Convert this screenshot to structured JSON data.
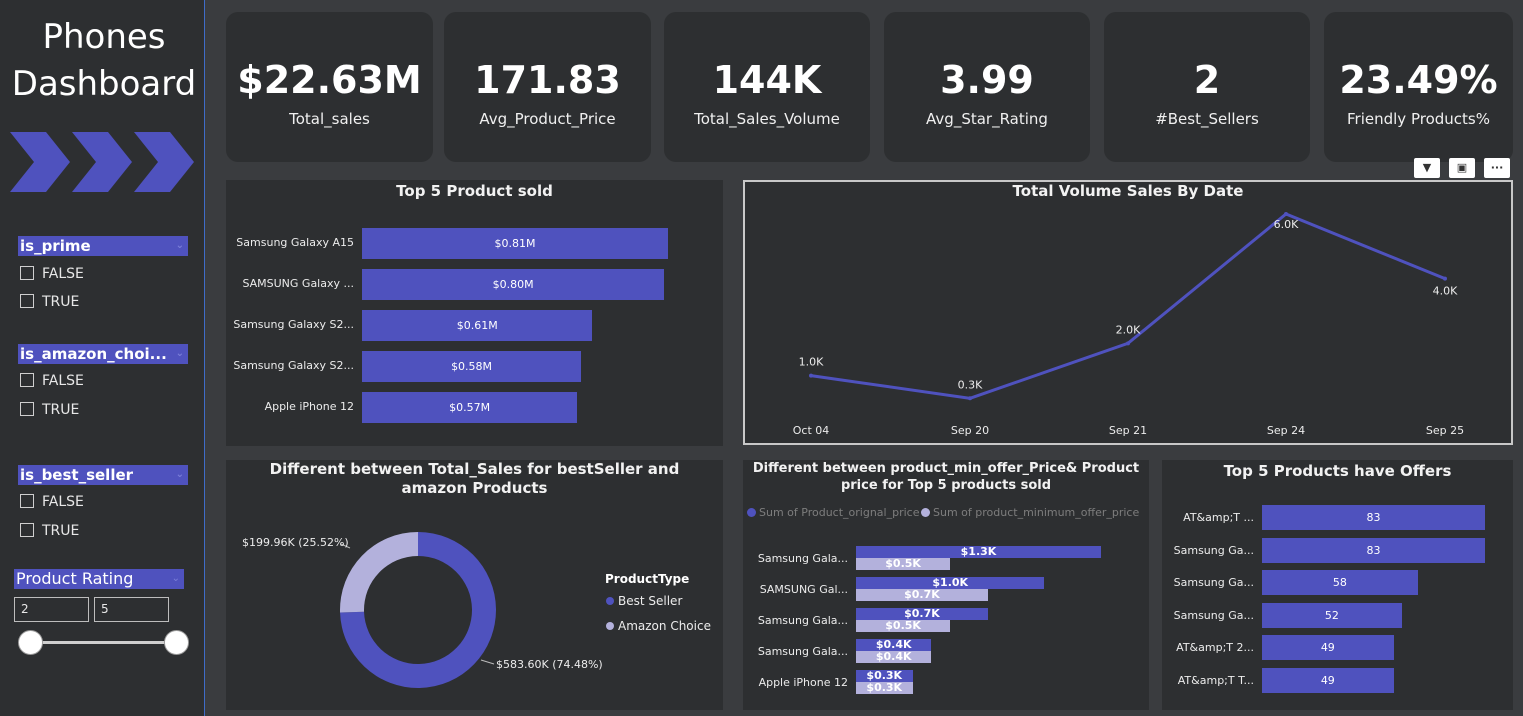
{
  "dashboard": {
    "title_line1": "Phones",
    "title_line2": "Dashboard"
  },
  "slicers": {
    "is_prime": {
      "label": "is_prime",
      "options": [
        "FALSE",
        "TRUE"
      ]
    },
    "is_amazon_choice": {
      "label": "is_amazon_choi...",
      "options": [
        "FALSE",
        "TRUE"
      ]
    },
    "is_best_seller": {
      "label": "is_best_seller",
      "options": [
        "FALSE",
        "TRUE"
      ]
    },
    "product_rating": {
      "label": "Product Rating",
      "min": "2",
      "max": "5"
    }
  },
  "kpis": [
    {
      "value": "$22.63M",
      "label": "Total_sales"
    },
    {
      "value": "171.83",
      "label": "Avg_Product_Price"
    },
    {
      "value": "144K",
      "label": "Total_Sales_Volume"
    },
    {
      "value": "3.99",
      "label": "Avg_Star_Rating"
    },
    {
      "value": "2",
      "label": "#Best_Sellers"
    },
    {
      "value": "23.49%",
      "label": "Friendly Products%"
    }
  ],
  "colors": {
    "primary": "#4f52be",
    "secondary": "#b3b1dc",
    "panel": "#2d2f31",
    "background": "#3a3c3f"
  },
  "chart_data": [
    {
      "type": "bar",
      "title": "Top 5 Product sold",
      "categories": [
        "Samsung Galaxy A15",
        "SAMSUNG Galaxy ...",
        "Samsung Galaxy S2...",
        "Samsung Galaxy S2...",
        "Apple iPhone 12"
      ],
      "values": [
        0.81,
        0.8,
        0.61,
        0.58,
        0.57
      ],
      "value_labels": [
        "$0.81M",
        "$0.80M",
        "$0.61M",
        "$0.58M",
        "$0.57M"
      ],
      "orientation": "horizontal"
    },
    {
      "type": "line",
      "title": "Total Volume Sales By Date",
      "categories": [
        "Oct 04",
        "Sep 20",
        "Sep 21",
        "Sep 24",
        "Sep 25"
      ],
      "values": [
        1.0,
        0.3,
        2.0,
        6.0,
        4.0
      ],
      "value_labels": [
        "1.0K",
        "0.3K",
        "2.0K",
        "6.0K",
        "4.0K"
      ]
    },
    {
      "type": "pie",
      "title": "Different between Total_Sales for bestSeller and amazon Products",
      "legend_title": "ProductType",
      "categories": [
        "Best Seller",
        "Amazon Choice"
      ],
      "values": [
        583.6,
        199.96
      ],
      "value_labels": [
        "$583.60K (74.48%)",
        "$199.96K (25.52%)"
      ]
    },
    {
      "type": "bar",
      "title": "Different between product_min_offer_Price& Product price for Top 5 products sold",
      "categories": [
        "Samsung Gala...",
        "SAMSUNG Gal...",
        "Samsung Gala...",
        "Samsung Gala...",
        "Apple iPhone 12"
      ],
      "series": [
        {
          "name": "Sum of Product_orignal_price",
          "values": [
            1.3,
            1.0,
            0.7,
            0.4,
            0.3
          ],
          "value_labels": [
            "$1.3K",
            "$1.0K",
            "$0.7K",
            "$0.4K",
            "$0.3K"
          ]
        },
        {
          "name": "Sum of product_minimum_offer_price",
          "values": [
            0.5,
            0.7,
            0.5,
            0.4,
            0.3
          ],
          "value_labels": [
            "$0.5K",
            "$0.7K",
            "$0.5K",
            "$0.4K",
            "$0.3K"
          ]
        }
      ],
      "orientation": "horizontal"
    },
    {
      "type": "bar",
      "title": "Top 5 Products have Offers",
      "categories": [
        "AT&amp;T ...",
        "Samsung Ga...",
        "Samsung Ga...",
        "Samsung Ga...",
        "AT&amp;T 2...",
        "AT&amp;T T..."
      ],
      "values": [
        83,
        83,
        58,
        52,
        49,
        49
      ],
      "value_labels": [
        "83",
        "83",
        "58",
        "52",
        "49",
        "49"
      ],
      "orientation": "horizontal"
    }
  ],
  "visual_toolbar": {
    "filter_icon": "filter-icon",
    "focus_icon": "focus-mode-icon",
    "more_label": "···"
  }
}
